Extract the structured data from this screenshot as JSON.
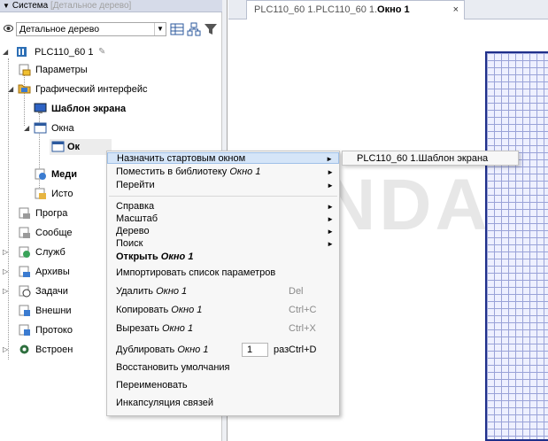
{
  "panel": {
    "title": "Система",
    "title_hint": "[Детальное дерево]",
    "tree_mode": "Детальное дерево"
  },
  "tree": {
    "root": "PLC110_60 1",
    "params": "Параметры",
    "gui": "Графический интерфейс",
    "screen_template": "Шаблон экрана",
    "windows": "Окна",
    "window1_partial": "Ок",
    "media_partial": "Меди",
    "sources_partial": "Исто",
    "programs_partial": "Програ",
    "messages_partial": "Сообще",
    "services_partial": "Служб",
    "archives_partial": "Архивы",
    "tasks_partial": "Задачи",
    "external_partial": "Внешни",
    "protocols_partial": "Протоко",
    "embedded_partial": "Встроен"
  },
  "document": {
    "tab_prefix": "PLC110_60 1.PLC110_60 1.",
    "tab_bold": "Окно 1",
    "tab_close": "×"
  },
  "menu": {
    "set_start": "Назначить стартовым окном",
    "put_library": "Поместить в библиотеку",
    "put_library_obj": "Окно 1",
    "goto": "Перейти",
    "help": "Справка",
    "scale": "Масштаб",
    "tree": "Дерево",
    "search": "Поиск",
    "open": "Открыть",
    "open_obj": "Окно 1",
    "import_params": "Импортировать список параметров",
    "delete": "Удалить",
    "delete_obj": "Окно 1",
    "delete_sc": "Del",
    "copy": "Копировать",
    "copy_obj": "Окно 1",
    "copy_sc": "Ctrl+C",
    "cut": "Вырезать",
    "cut_obj": "Окно 1",
    "cut_sc": "Ctrl+X",
    "duplicate": "Дублировать",
    "duplicate_obj": "Окно 1",
    "duplicate_count": "1",
    "duplicate_unit": "раз",
    "duplicate_sc": "Ctrl+D",
    "restore_defaults": "Восстановить умолчания",
    "rename": "Переименовать",
    "encapsulate": "Инкапсуляция связей"
  },
  "submenu": {
    "item": "PLC110_60 1.Шаблон экрана"
  },
  "watermark": "OLUNDA",
  "colors": {
    "highlight": "#d5e5f8",
    "grid_border": "#1f2f8a",
    "panel_header": "#d6dbe9"
  }
}
